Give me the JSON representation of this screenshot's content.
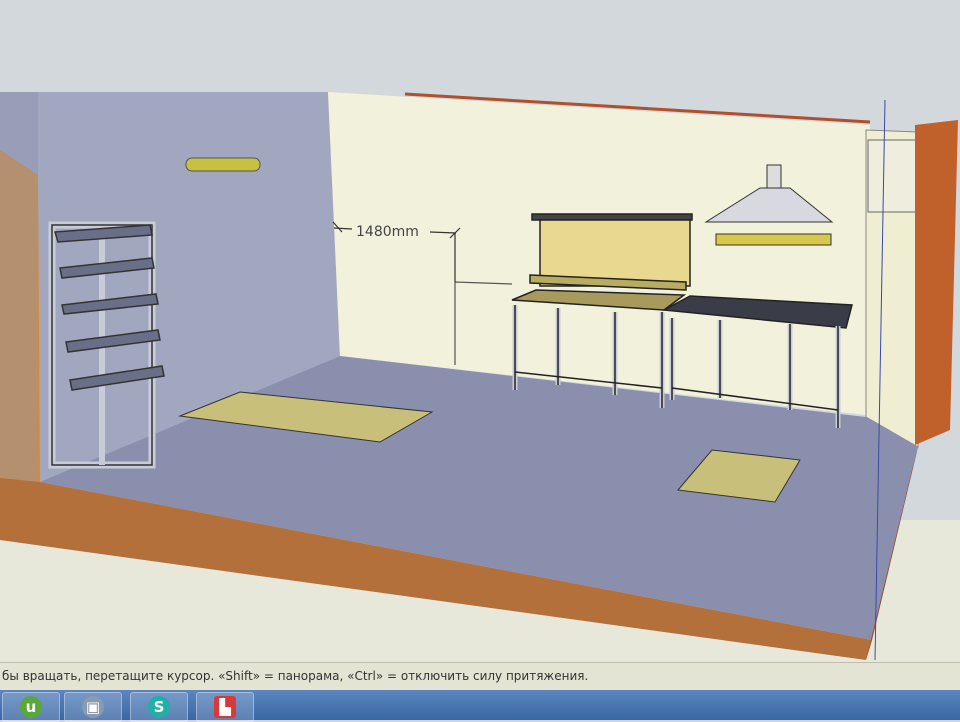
{
  "viewport": {
    "dimension_label": "1480mm"
  },
  "status_bar": {
    "hint": "бы вращать, перетащите курсор. «Shift» = панорама, «Ctrl» = отключить силу притяжения."
  },
  "taskbar": {
    "items": [
      {
        "icon": "utorrent-icon",
        "glyph": "u",
        "color": "#5aa83a"
      },
      {
        "icon": "virtualbox-icon",
        "glyph": "▣",
        "color": "#8a9ab0"
      },
      {
        "icon": "skype-icon",
        "glyph": "S",
        "color": "#1fb0a8"
      },
      {
        "icon": "sketchup-icon",
        "glyph": "▙",
        "color": "#d83a3a"
      }
    ]
  }
}
